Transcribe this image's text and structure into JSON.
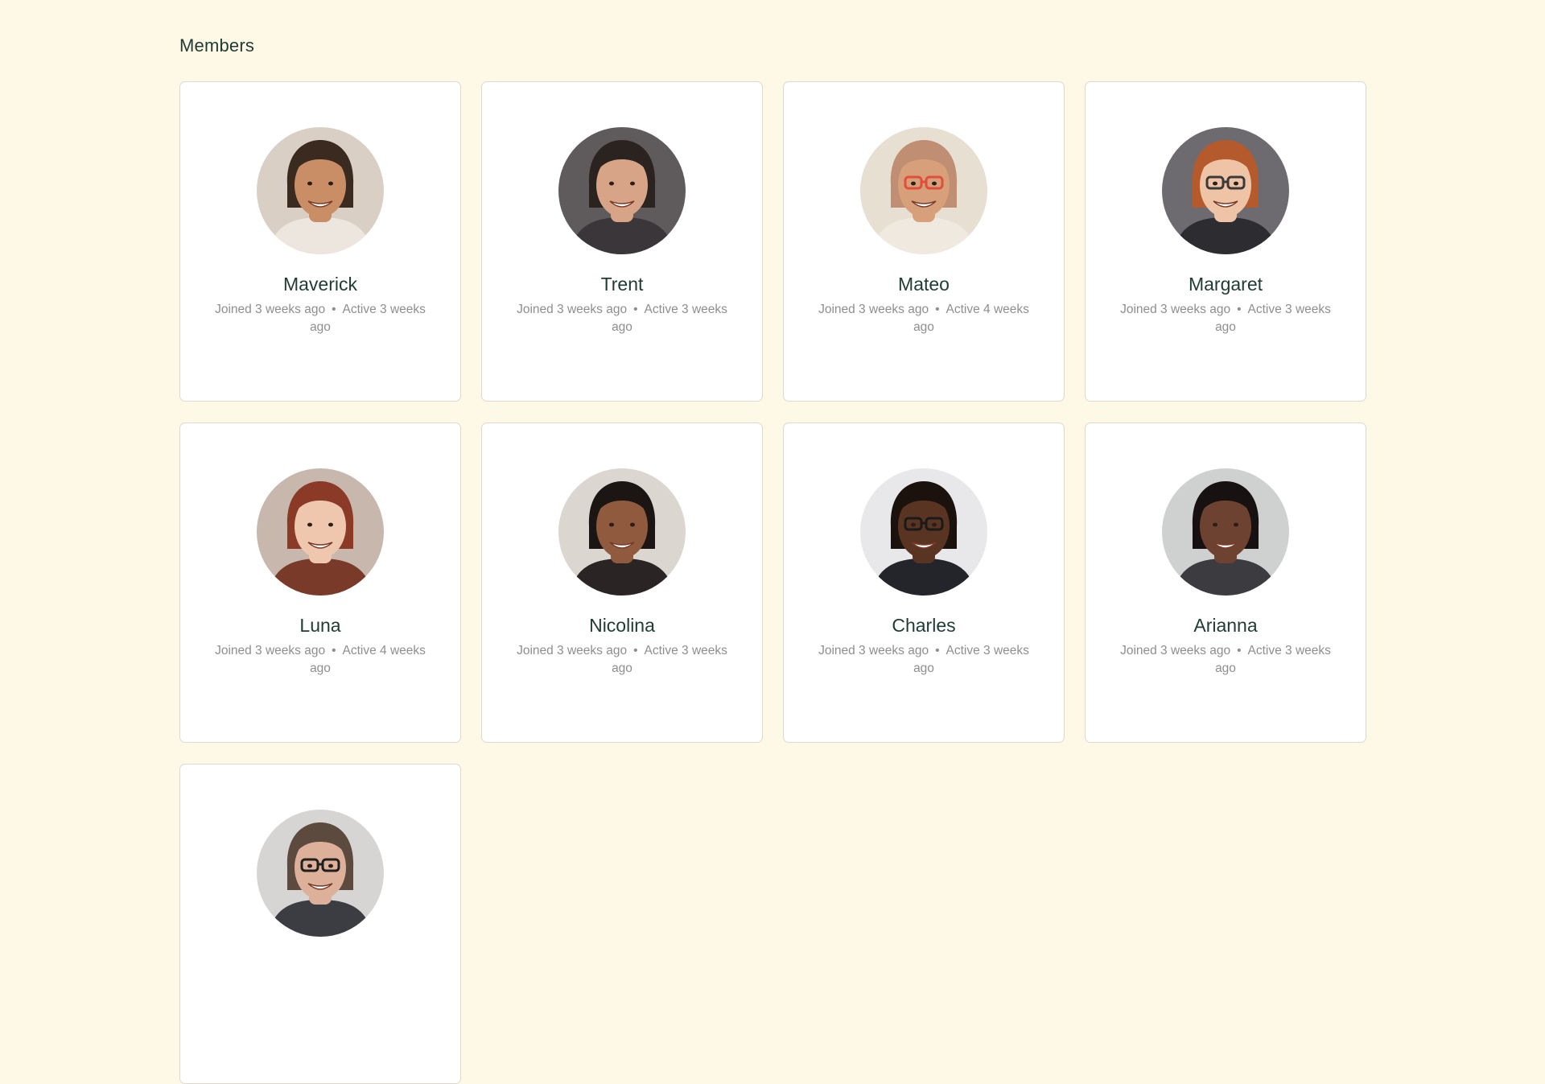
{
  "section_title": "Members",
  "separator": "•",
  "members": [
    {
      "name": "Maverick",
      "joined": "Joined 3 weeks ago",
      "active": "Active 3 weeks ago",
      "avatar": {
        "bg": "#d9cfc4",
        "skin": "#c98e66",
        "hair": "#3a2a1f",
        "shirt": "#ece6de"
      }
    },
    {
      "name": "Trent",
      "joined": "Joined 3 weeks ago",
      "active": "Active 3 weeks ago",
      "avatar": {
        "bg": "#5f5a5c",
        "skin": "#d8a487",
        "hair": "#2a2320",
        "shirt": "#3b3639"
      }
    },
    {
      "name": "Mateo",
      "joined": "Joined 3 weeks ago",
      "active": "Active 4 weeks ago",
      "avatar": {
        "bg": "#e6dfd2",
        "skin": "#d7a07a",
        "hair": "#c08e73",
        "shirt": "#efe9df",
        "glasses": "#e04e3c"
      }
    },
    {
      "name": "Margaret",
      "joined": "Joined 3 weeks ago",
      "active": "Active 3 weeks ago",
      "avatar": {
        "bg": "#6d6b70",
        "skin": "#efc4a6",
        "hair": "#b55a2c",
        "shirt": "#2d2c31",
        "glasses": "#3a3a3a"
      }
    },
    {
      "name": "Luna",
      "joined": "Joined 3 weeks ago",
      "active": "Active 4 weeks ago",
      "avatar": {
        "bg": "#c7b7ad",
        "skin": "#efc7ae",
        "hair": "#8a3a26",
        "shirt": "#7a3a2a"
      }
    },
    {
      "name": "Nicolina",
      "joined": "Joined 3 weeks ago",
      "active": "Active 3 weeks ago",
      "avatar": {
        "bg": "#dcd6d0",
        "skin": "#8f5a3e",
        "hair": "#1b1513",
        "shirt": "#2a2424"
      }
    },
    {
      "name": "Charles",
      "joined": "Joined 3 weeks ago",
      "active": "Active 3 weeks ago",
      "avatar": {
        "bg": "#e8e8ea",
        "skin": "#5a3423",
        "hair": "#1c120d",
        "shirt": "#23252b",
        "glasses": "#1a1a1a"
      }
    },
    {
      "name": "Arianna",
      "joined": "Joined 3 weeks ago",
      "active": "Active 3 weeks ago",
      "avatar": {
        "bg": "#cfd1d1",
        "skin": "#6e4230",
        "hair": "#171211",
        "shirt": "#3b3b40"
      }
    },
    {
      "name": "",
      "joined": "",
      "active": "",
      "avatar": {
        "bg": "#d7d5d3",
        "skin": "#ddb09a",
        "hair": "#5c4a3e",
        "shirt": "#3c3d42",
        "glasses": "#1f1f1f"
      }
    }
  ]
}
